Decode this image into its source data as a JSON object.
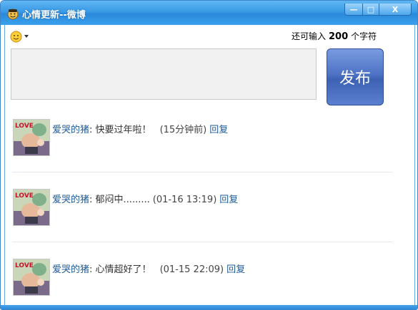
{
  "window": {
    "title": "心情更新--微博",
    "minimize_label": "—",
    "maximize_label": "□",
    "close_label": "X"
  },
  "compose": {
    "counter_prefix": "还可输入",
    "counter_value": "200",
    "counter_suffix": "个字符",
    "publish_label": "发布",
    "text_value": ""
  },
  "feed": [
    {
      "user": "爱哭的猪",
      "colon": ":",
      "message": "快要过年啦！",
      "time": "(15分钟前)",
      "reply": "回复"
    },
    {
      "user": "爱哭的猪",
      "colon": ":",
      "message": "郁闷中.........",
      "time": "(01-16 13:19)",
      "reply": "回复"
    },
    {
      "user": "爱哭的猪",
      "colon": ":",
      "message": "心情超好了！",
      "time": "(01-15 22:09)",
      "reply": "回复"
    }
  ],
  "icons": {
    "title_icon": "smiley-hat-icon",
    "emoji": "smiley-icon",
    "avatar": "avatar-love-picture"
  }
}
